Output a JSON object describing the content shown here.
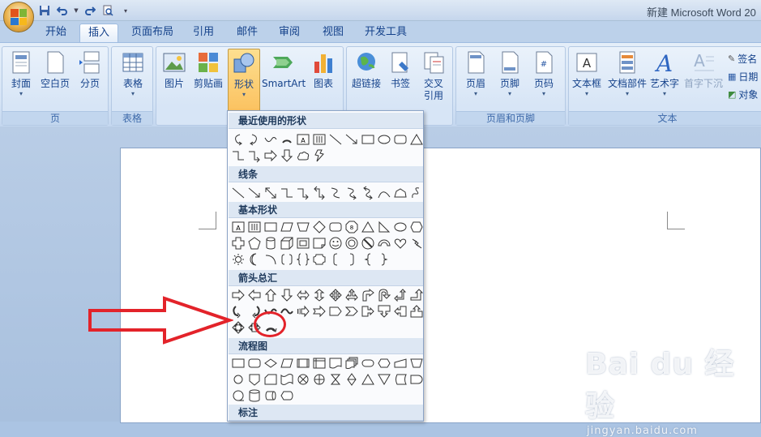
{
  "window": {
    "title": "新建 Microsoft Word 20"
  },
  "tabs": [
    {
      "label": "开始"
    },
    {
      "label": "插入",
      "active": true
    },
    {
      "label": "页面布局"
    },
    {
      "label": "引用"
    },
    {
      "label": "邮件"
    },
    {
      "label": "审阅"
    },
    {
      "label": "视图"
    },
    {
      "label": "开发工具"
    }
  ],
  "ribbon": {
    "groups": {
      "pages": {
        "label": "页",
        "buttons": [
          "封面",
          "空白页",
          "分页"
        ]
      },
      "tables": {
        "label": "表格",
        "buttons": [
          "表格"
        ]
      },
      "illustrations": {
        "buttons": [
          "图片",
          "剪贴画",
          "形状",
          "SmartArt",
          "图表"
        ]
      },
      "links": {
        "buttons": [
          "超链接",
          "书签",
          "交叉",
          "引用"
        ]
      },
      "header_footer": {
        "label": "页眉和页脚",
        "buttons": [
          "页眉",
          "页脚",
          "页码"
        ]
      },
      "text": {
        "label": "文本",
        "buttons": [
          "文本框",
          "文档部件",
          "艺术字",
          "首字下沉"
        ],
        "small": [
          "签名",
          "日期",
          "对象"
        ]
      }
    }
  },
  "shapes_menu": {
    "sections": [
      "最近使用的形状",
      "线条",
      "基本形状",
      "箭头总汇",
      "流程图",
      "标注"
    ]
  },
  "watermark": {
    "main": "Bai du 经验",
    "sub": "jingyan.baidu.com"
  },
  "colors": {
    "ribbon": "#dbe7f6",
    "accent_orange": "#fbc260",
    "annotation_red": "#e3232a"
  }
}
